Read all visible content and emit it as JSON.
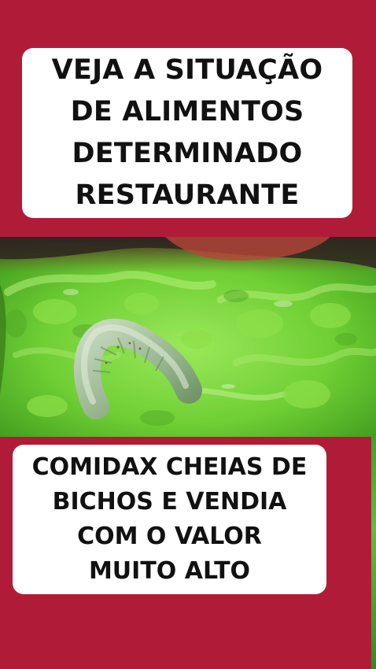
{
  "top_caption": {
    "lines": [
      "VEJA A SITUAÇÃO",
      "DE ALIMENTOS",
      "DETERMINADO",
      "RESTAURANTE"
    ]
  },
  "bottom_caption": {
    "lines": [
      "COMIDAX CHEIAS DE",
      "BICHOS E VENDIA",
      "COM O VALOR",
      "MUITO ALTO"
    ]
  },
  "colors": {
    "background": "#b01c38",
    "caption_box": "#ffffff",
    "caption_text": "#111111",
    "lettuce": "#79d63c",
    "worm": "#a9c4a3"
  },
  "photo": {
    "subject": "worm-on-lettuce"
  }
}
